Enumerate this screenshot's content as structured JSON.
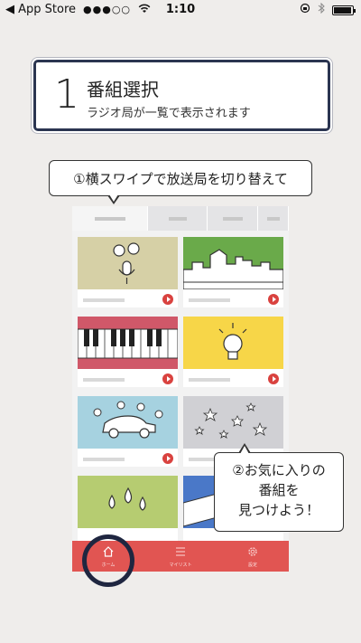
{
  "status_bar": {
    "back_label": "◀ App Store",
    "signal": "●●●○○",
    "time": "1:10"
  },
  "heading": {
    "number": "1",
    "title": "番組選択",
    "subtitle": "ラジオ局が一覧で表示されます"
  },
  "callout_top": "①横スワイプで放送局を切り替えて",
  "callout_bottom": {
    "line1": "②お気に入りの",
    "line2": "番組を",
    "line3": "見つけよう！"
  },
  "tabs": [
    "",
    "",
    "",
    ""
  ],
  "cards": [
    {
      "art": "microphone-speech-icon",
      "color": "#d6d0a6"
    },
    {
      "art": "city-skyline-icon",
      "color": "#6aaa4a"
    },
    {
      "art": "piano-keys-icon",
      "color": "#d05869"
    },
    {
      "art": "lightbulb-icon",
      "color": "#f7d648"
    },
    {
      "art": "car-music-icon",
      "color": "#a6d2e0"
    },
    {
      "art": "stars-icon",
      "color": "#d0d0d4"
    },
    {
      "art": "water-drops-icon",
      "color": "#b6cc71"
    },
    {
      "art": "film-strip-icon",
      "color": "#4a78c8"
    }
  ],
  "nav": {
    "items": [
      {
        "label": "ホーム",
        "icon": "home-icon"
      },
      {
        "label": "マイリスト",
        "icon": "list-icon"
      },
      {
        "label": "設定",
        "icon": "gear-icon"
      }
    ],
    "color": "#e15552"
  }
}
